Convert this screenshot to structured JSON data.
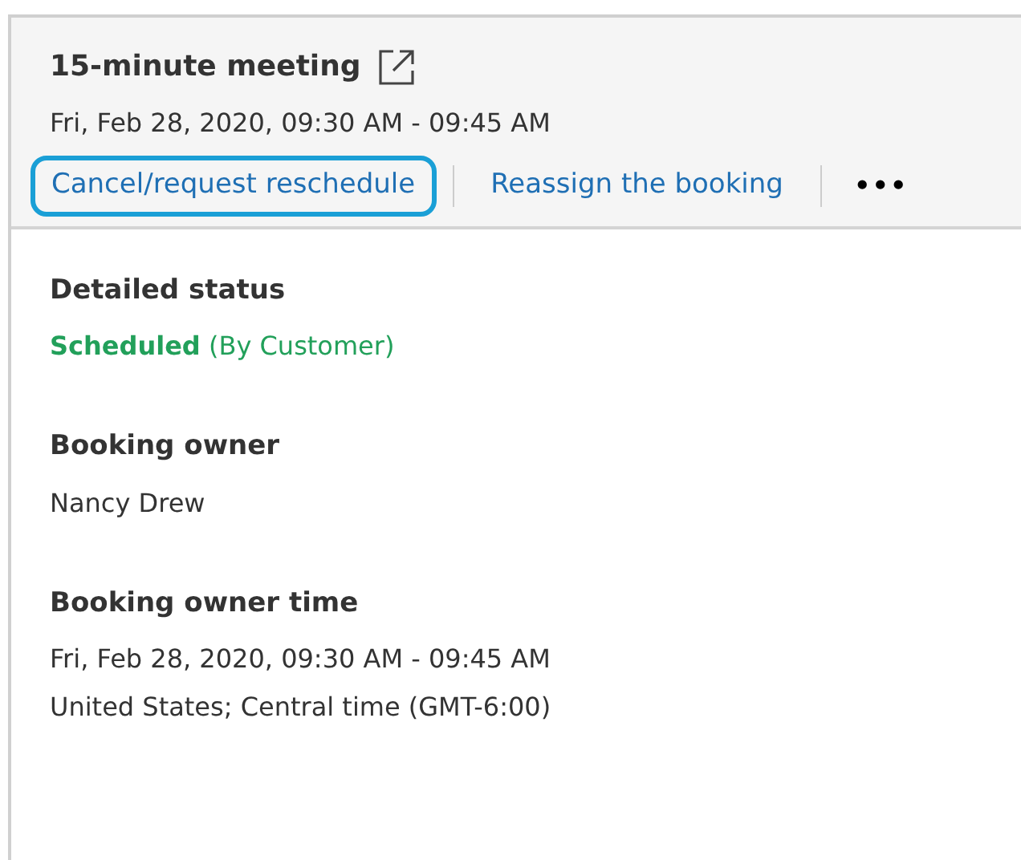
{
  "header": {
    "title": "15-minute meeting",
    "datetime": "Fri, Feb 28, 2020, 09:30 AM - 09:45 AM",
    "actions": [
      {
        "kind": "link",
        "label": "Cancel/request reschedule",
        "focused": true
      },
      {
        "kind": "link",
        "label": "Reassign the booking",
        "focused": false
      },
      {
        "kind": "more",
        "label": "•••",
        "focused": false
      }
    ]
  },
  "fields": [
    {
      "label": "Detailed status",
      "lines": [
        "**Scheduled** (By Customer)"
      ],
      "color": "#22a05a"
    },
    {
      "label": "Booking owner",
      "lines": [
        "Nancy Drew"
      ]
    },
    {
      "label": "Booking owner time",
      "lines": [
        "Fri, Feb 28, 2020, 09:30 AM - 09:45 AM",
        "United States; Central time (GMT-6:00)"
      ]
    }
  ]
}
